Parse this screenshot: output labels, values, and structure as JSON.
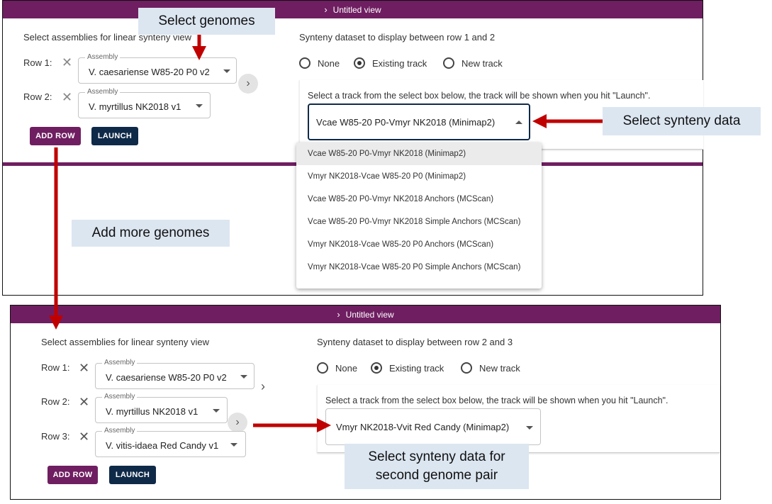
{
  "colors": {
    "brand": "#6f1e61",
    "navy": "#0f2a48",
    "arrow": "#c00000",
    "callout_bg": "#dce6f1"
  },
  "panel1": {
    "title": "Untitled view",
    "assemblies_heading": "Select assemblies for linear synteny view",
    "rows": [
      {
        "label": "Row 1:",
        "legend": "Assembly",
        "value": "V. caesariense W85-20 P0 v2"
      },
      {
        "label": "Row 2:",
        "legend": "Assembly",
        "value": "V. myrtillus NK2018 v1"
      }
    ],
    "add_row": "ADD ROW",
    "launch": "LAUNCH",
    "synteny_heading": "Synteny dataset to display between row 1 and 2",
    "radios": [
      "None",
      "Existing track",
      "New track"
    ],
    "selected_radio": "Existing track",
    "track_hint": "Select a track from the select box below, the track will be shown when you hit \"Launch\".",
    "track_value": "Vcae W85-20 P0-Vmyr NK2018 (Minimap2)",
    "options": [
      "Vcae W85-20 P0-Vmyr NK2018 (Minimap2)",
      "Vmyr NK2018-Vcae W85-20 P0 (Minimap2)",
      "Vcae W85-20 P0-Vmyr NK2018 Anchors (MCScan)",
      "Vcae W85-20 P0-Vmyr NK2018 Simple Anchors (MCScan)",
      "Vmyr NK2018-Vcae W85-20 P0 Anchors (MCScan)",
      "Vmyr NK2018-Vcae W85-20 P0 Simple Anchors (MCScan)"
    ]
  },
  "panel2": {
    "title": "Untitled view",
    "assemblies_heading": "Select assemblies for linear synteny view",
    "rows": [
      {
        "label": "Row 1:",
        "legend": "Assembly",
        "value": "V. caesariense W85-20 P0 v2"
      },
      {
        "label": "Row 2:",
        "legend": "Assembly",
        "value": "V. myrtillus NK2018 v1"
      },
      {
        "label": "Row 3:",
        "legend": "Assembly",
        "value": "V. vitis-idaea Red Candy v1"
      }
    ],
    "add_row": "ADD ROW",
    "launch": "LAUNCH",
    "synteny_heading": "Synteny dataset to display between row 2 and 3",
    "radios": [
      "None",
      "Existing track",
      "New track"
    ],
    "selected_radio": "Existing track",
    "track_hint": "Select a track from the select box below, the track will be shown when you hit \"Launch\".",
    "track_value": "Vmyr NK2018-Vvit Red Candy (Minimap2)"
  },
  "callouts": {
    "select_genomes": "Select genomes",
    "select_synteny": "Select synteny data",
    "add_more": "Add more genomes",
    "second_pair": "Select synteny data for second genome pair"
  }
}
